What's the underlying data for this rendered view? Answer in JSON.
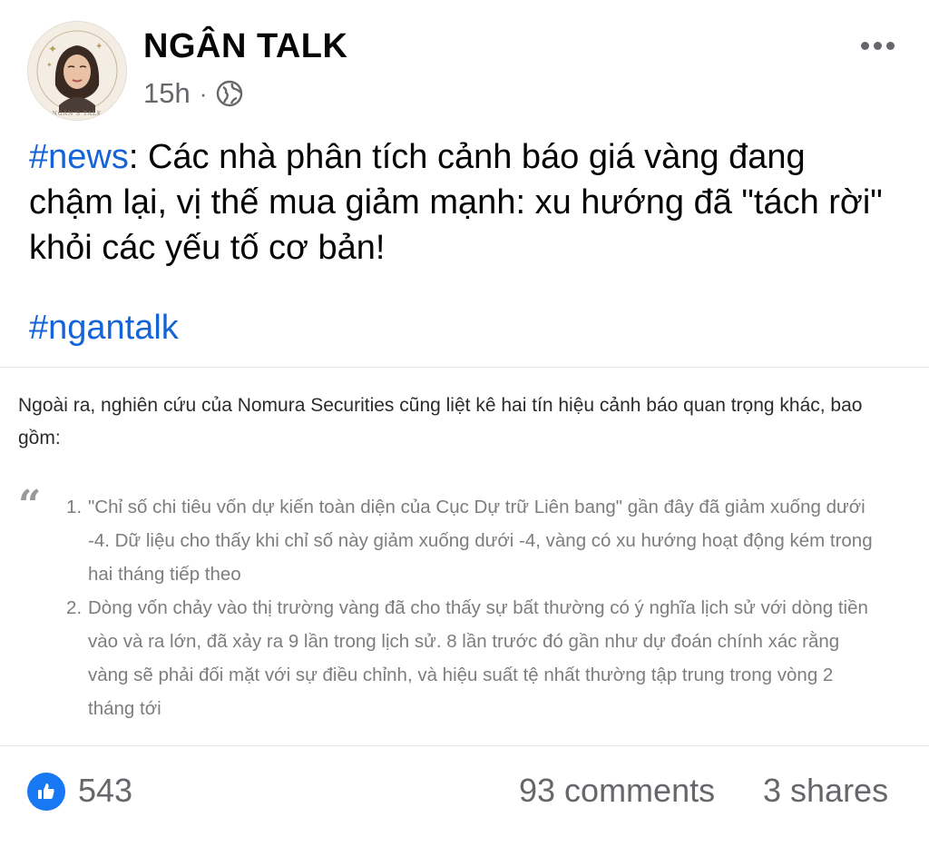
{
  "post": {
    "author": "NGÂN TALK",
    "time": "15h",
    "separator": "·",
    "privacy_icon": "globe-icon",
    "more_icon": "more-options-icon",
    "avatar_logo_text": "NGÂN'S TALK",
    "caption": {
      "hashtag": "#news",
      "text": ": Các nhà phân tích cảnh báo giá vàng đang chậm lại, vị thế mua giảm mạnh: xu hướng đã \"tách rời\" khỏi các yếu tố cơ bản!",
      "hashtag2": "#ngantalk"
    },
    "attachment": {
      "intro": "Ngoài ra, nghiên cứu của Nomura Securities cũng liệt kê hai tín hiệu cảnh báo quan trọng khác, bao gồm:",
      "quote_mark": "“",
      "items": [
        {
          "num": "1.",
          "text": "\"Chỉ số chi tiêu vốn dự kiến toàn diện của Cục Dự trữ Liên bang\" gần đây đã giảm xuống dưới -4. Dữ liệu cho thấy khi chỉ số này giảm xuống dưới -4, vàng có xu hướng hoạt động kém trong hai tháng tiếp theo"
        },
        {
          "num": "2.",
          "text": "Dòng vốn chảy vào thị trường vàng đã cho thấy sự bất thường có ý nghĩa lịch sử với dòng tiền vào và ra lớn, đã xảy ra 9 lần trong lịch sử. 8 lần trước đó gần như dự đoán chính xác rằng vàng sẽ phải đối mặt với sự điều chỉnh, và hiệu suất tệ nhất thường tập trung trong vòng 2 tháng tới"
        }
      ]
    },
    "footer": {
      "like_icon": "like-thumb-icon",
      "likes": "543",
      "comments": "93 comments",
      "shares": "3 shares"
    }
  },
  "colors": {
    "hashtag": "#1464d8",
    "like_blue": "#1877f2",
    "secondary_text": "#65676b"
  }
}
